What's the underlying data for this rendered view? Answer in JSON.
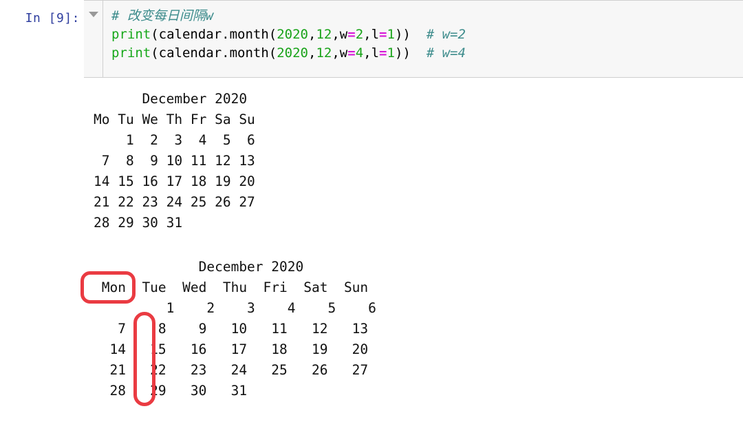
{
  "notebook": {
    "input_cell": {
      "prompt_label": "In [9]:",
      "collapse_icon": "chevron-down-icon",
      "code_lines": [
        {
          "id": "line-1",
          "tokens": [
            {
              "type": "comment",
              "text": "# 改变每日间隔w"
            }
          ]
        },
        {
          "id": "line-2",
          "tokens": [
            {
              "type": "builtin",
              "text": "print"
            },
            {
              "type": "plain",
              "text": "(calendar.month("
            },
            {
              "type": "num",
              "text": "2020"
            },
            {
              "type": "plain",
              "text": ","
            },
            {
              "type": "num",
              "text": "12"
            },
            {
              "type": "plain",
              "text": ",w"
            },
            {
              "type": "op",
              "text": "="
            },
            {
              "type": "num",
              "text": "2"
            },
            {
              "type": "plain",
              "text": ",l"
            },
            {
              "type": "op",
              "text": "="
            },
            {
              "type": "num",
              "text": "1"
            },
            {
              "type": "plain",
              "text": "))  "
            },
            {
              "type": "comment",
              "text": "# w=2"
            }
          ]
        },
        {
          "id": "line-3",
          "tokens": [
            {
              "type": "builtin",
              "text": "print"
            },
            {
              "type": "plain",
              "text": "(calendar.month("
            },
            {
              "type": "num",
              "text": "2020"
            },
            {
              "type": "plain",
              "text": ","
            },
            {
              "type": "num",
              "text": "12"
            },
            {
              "type": "plain",
              "text": ",w"
            },
            {
              "type": "op",
              "text": "="
            },
            {
              "type": "num",
              "text": "4"
            },
            {
              "type": "plain",
              "text": ",l"
            },
            {
              "type": "op",
              "text": "="
            },
            {
              "type": "num",
              "text": "1"
            },
            {
              "type": "plain",
              "text": "))  "
            },
            {
              "type": "comment",
              "text": "# w=4"
            }
          ]
        }
      ]
    },
    "outputs": {
      "calendar_w2": {
        "title": "December 2020",
        "weekday_headers": [
          "Mo",
          "Tu",
          "We",
          "Th",
          "Fr",
          "Sa",
          "Su"
        ],
        "weeks": [
          [
            "",
            "1",
            "2",
            "3",
            "4",
            "5",
            "6"
          ],
          [
            "7",
            "8",
            "9",
            "10",
            "11",
            "12",
            "13"
          ],
          [
            "14",
            "15",
            "16",
            "17",
            "18",
            "19",
            "20"
          ],
          [
            "21",
            "22",
            "23",
            "24",
            "25",
            "26",
            "27"
          ],
          [
            "28",
            "29",
            "30",
            "31",
            "",
            "",
            ""
          ]
        ],
        "text": "      December 2020\nMo Tu We Th Fr Sa Su\n    1  2  3  4  5  6\n 7  8  9 10 11 12 13\n14 15 16 17 18 19 20\n21 22 23 24 25 26 27\n28 29 30 31"
      },
      "calendar_w4": {
        "title": "December 2020",
        "weekday_headers": [
          "Mon",
          "Tue",
          "Wed",
          "Thu",
          "Fri",
          "Sat",
          "Sun"
        ],
        "weeks": [
          [
            "",
            "1",
            "2",
            "3",
            "4",
            "5",
            "6"
          ],
          [
            "7",
            "8",
            "9",
            "10",
            "11",
            "12",
            "13"
          ],
          [
            "14",
            "15",
            "16",
            "17",
            "18",
            "19",
            "20"
          ],
          [
            "21",
            "22",
            "23",
            "24",
            "25",
            "26",
            "27"
          ],
          [
            "28",
            "29",
            "30",
            "31",
            "",
            "",
            ""
          ]
        ],
        "text": "             December 2020\n Mon  Tue  Wed  Thu  Fri  Sat  Sun\n         1    2    3    4    5    6\n   7    8    9   10   11   12   13\n  14   15   16   17   18   19   20\n  21   22   23   24   25   26   27\n  28   29   30   31"
      }
    },
    "annotations": {
      "color": "#ea3b42",
      "boxes": [
        {
          "id": "mon-header-highlight",
          "target": "Mon"
        },
        {
          "id": "column-spacing-highlight",
          "target": "monday-column-gap"
        }
      ]
    }
  }
}
